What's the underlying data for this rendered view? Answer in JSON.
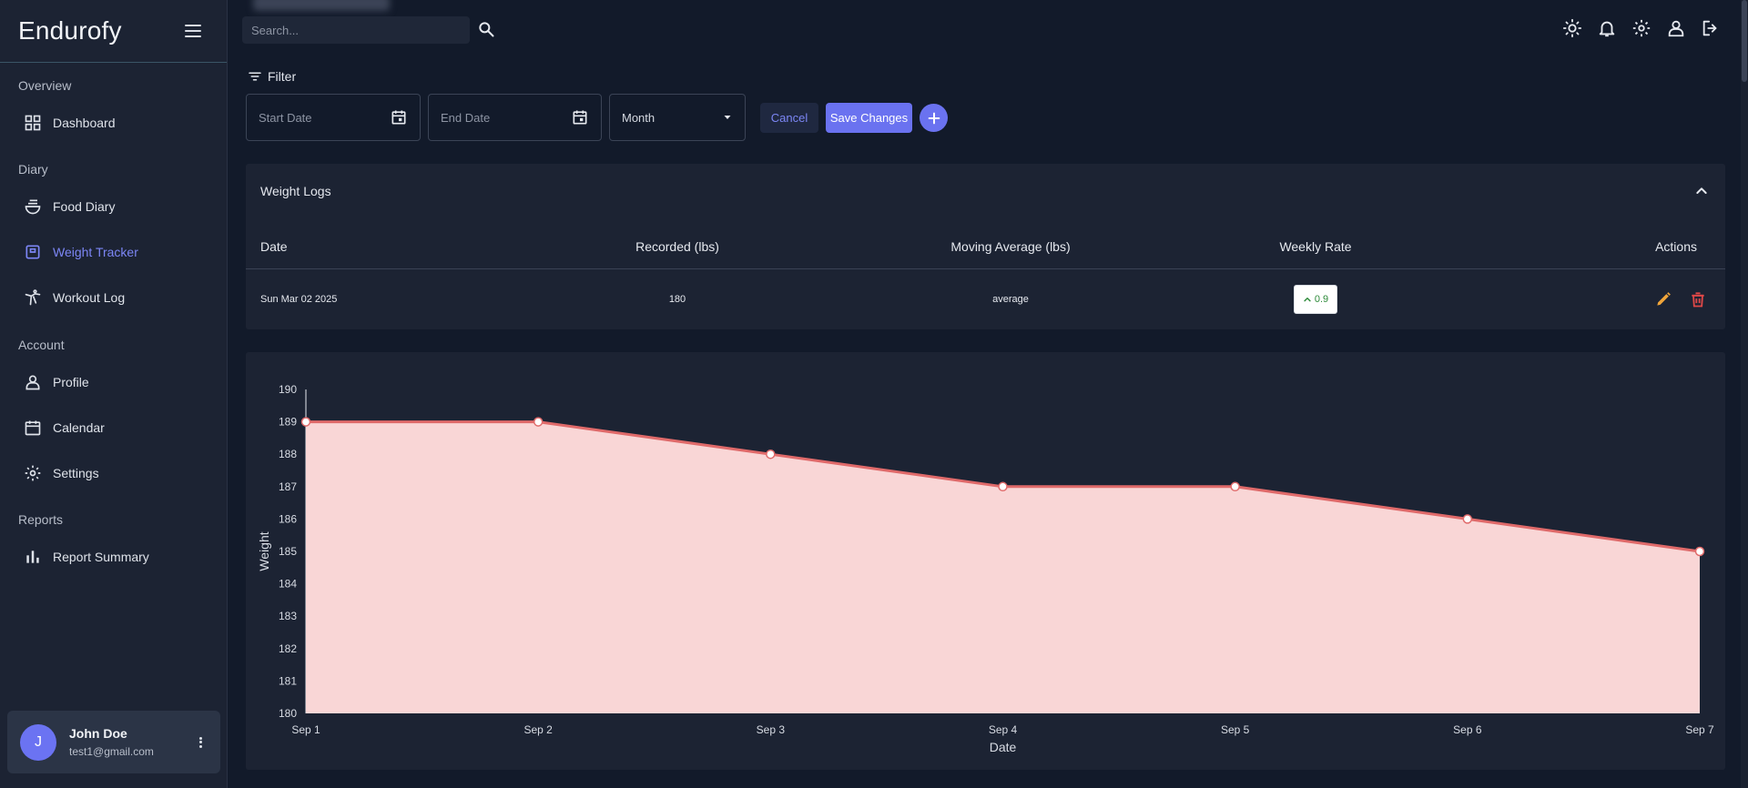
{
  "app": {
    "brand": "Endurofy"
  },
  "sidebar": {
    "sections": [
      {
        "label": "Overview"
      },
      {
        "label": "Diary"
      },
      {
        "label": "Account"
      },
      {
        "label": "Reports"
      }
    ],
    "items": [
      {
        "label": "Dashboard",
        "icon": "dashboard-icon"
      },
      {
        "label": "Food Diary",
        "icon": "food-bowl-icon"
      },
      {
        "label": "Weight Tracker",
        "icon": "scale-icon",
        "active": true
      },
      {
        "label": "Workout Log",
        "icon": "workout-icon"
      },
      {
        "label": "Profile",
        "icon": "person-icon"
      },
      {
        "label": "Calendar",
        "icon": "calendar-icon"
      },
      {
        "label": "Settings",
        "icon": "gear-icon"
      },
      {
        "label": "Report Summary",
        "icon": "bar-chart-icon"
      }
    ]
  },
  "user": {
    "initial": "J",
    "name": "John Doe",
    "email": "test1@gmail.com"
  },
  "topbar": {
    "search_placeholder": "Search...",
    "icons": [
      "sun-icon",
      "bell-icon",
      "gear-icon",
      "person-icon",
      "logout-icon"
    ]
  },
  "filter": {
    "label": "Filter",
    "start_date_placeholder": "Start Date",
    "end_date_placeholder": "End Date",
    "period_value": "Month",
    "cancel_label": "Cancel",
    "save_label": "Save Changes"
  },
  "table": {
    "title": "Weight Logs",
    "columns": [
      "Date",
      "Recorded (lbs)",
      "Moving Average (lbs)",
      "Weekly Rate",
      "Actions"
    ],
    "rows": [
      {
        "date": "Sun Mar 02 2025",
        "recorded": "180",
        "moving_average": "average",
        "weekly_rate": "0.9",
        "rate_direction": "up"
      }
    ]
  },
  "colors": {
    "accent": "#6a72f0",
    "line": "#e06a6a",
    "area_fill": "#f9d6d6",
    "edit": "#f0a53a",
    "delete": "#e04848",
    "rate_up": "#2e8b3a"
  },
  "chart_data": {
    "type": "area",
    "title": "",
    "xlabel": "Date",
    "ylabel": "Weight",
    "x": [
      "Sep 1",
      "Sep 2",
      "Sep 3",
      "Sep 4",
      "Sep 5",
      "Sep 6",
      "Sep 7"
    ],
    "series": [
      {
        "values": [
          189,
          189,
          188,
          187,
          187,
          186,
          185
        ]
      }
    ],
    "ylim": [
      180,
      190
    ],
    "yticks": [
      180,
      181,
      182,
      183,
      184,
      185,
      186,
      187,
      188,
      189,
      190
    ],
    "grid": false,
    "legend": "none"
  }
}
